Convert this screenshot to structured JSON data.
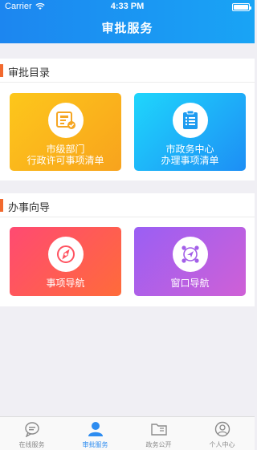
{
  "status_bar": {
    "carrier": "Carrier",
    "time": "4:33 PM"
  },
  "header": {
    "title": "审批服务"
  },
  "approval_catalog": {
    "title": "审批目录",
    "cards": [
      {
        "label_line1": "市级部门",
        "label_line2": "行政许可事项清单",
        "icon": "document-check-icon",
        "gradient": [
          "#fcc31a",
          "#f9a01c"
        ]
      },
      {
        "label_line1": "市政务中心",
        "label_line2": "办理事项清单",
        "icon": "clipboard-list-icon",
        "gradient": [
          "#1fd0fb",
          "#1e90f6"
        ]
      }
    ]
  },
  "guide": {
    "title": "办事向导",
    "cards": [
      {
        "label": "事项导航",
        "icon": "compass-icon",
        "gradient": [
          "#ff4f6b",
          "#ff6c3d"
        ]
      },
      {
        "label": "窗口导航",
        "icon": "location-nav-icon",
        "gradient": [
          "#9e5ff2",
          "#c85fd9"
        ]
      }
    ]
  },
  "tabbar": {
    "items": [
      {
        "label": "在线服务",
        "icon": "chat-bubble-icon",
        "active": false
      },
      {
        "label": "审批服务",
        "icon": "person-icon",
        "active": true
      },
      {
        "label": "政务公开",
        "icon": "folder-icon",
        "active": false
      },
      {
        "label": "个人中心",
        "icon": "profile-icon",
        "active": false
      }
    ]
  },
  "colors": {
    "brand": "#1c86f0",
    "accent": "#f2692e",
    "tab_active": "#2d8cf0",
    "tab_inactive": "#8a8a8a"
  }
}
